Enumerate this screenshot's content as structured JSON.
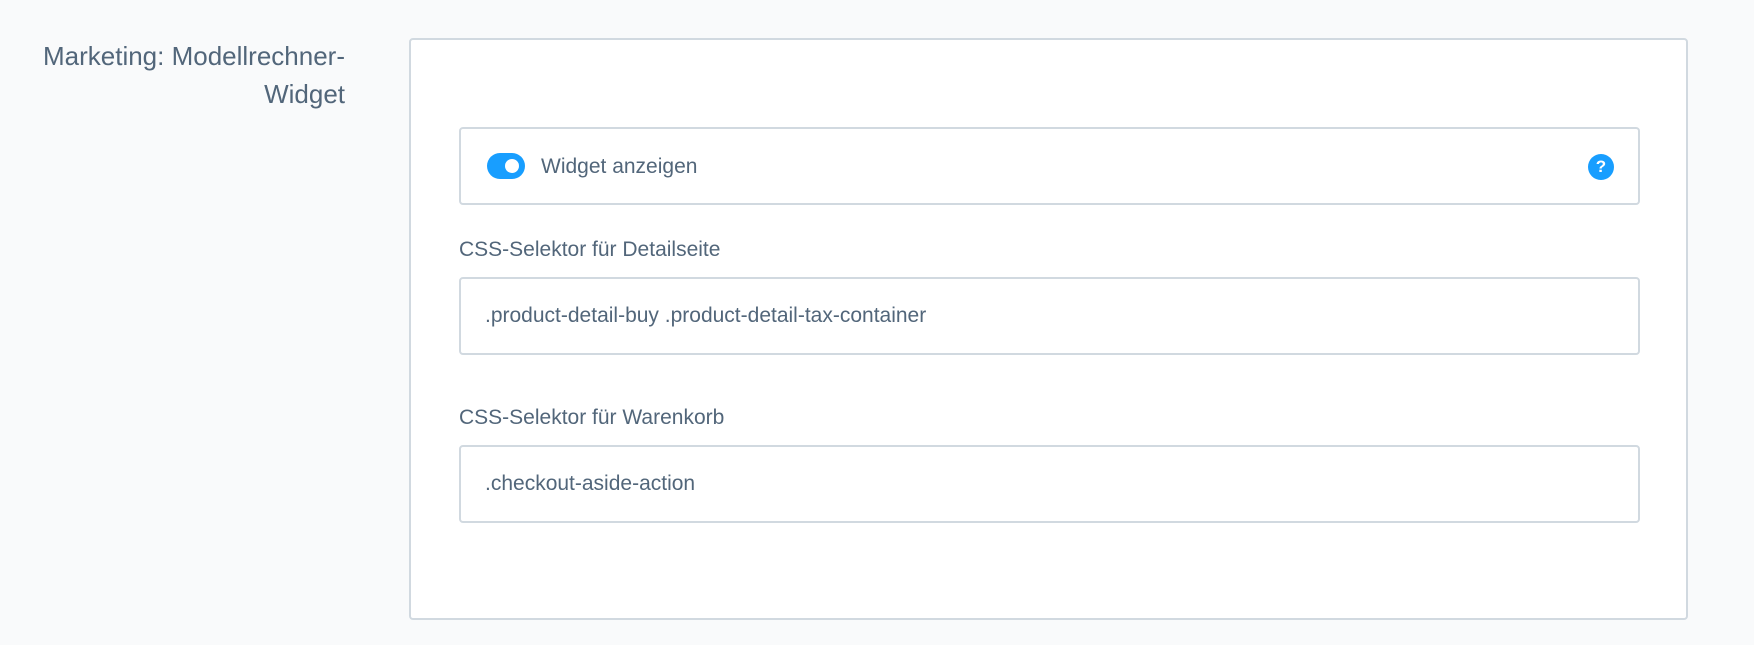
{
  "section": {
    "title_line1": "Marketing: Modellrechner-",
    "title_line2": "Widget"
  },
  "widget_toggle": {
    "label": "Widget anzeigen",
    "enabled": true,
    "help_icon": "question-mark-icon",
    "help_glyph": "?"
  },
  "fields": {
    "detail": {
      "label": "CSS-Selektor für Detailseite",
      "value": ".product-detail-buy .product-detail-tax-container"
    },
    "cart": {
      "label": "CSS-Selektor für Warenkorb",
      "value": ".checkout-aside-action"
    }
  },
  "colors": {
    "accent": "#189eff",
    "text": "#52667a",
    "border": "#d1d9e0",
    "background": "#f9fafb"
  }
}
